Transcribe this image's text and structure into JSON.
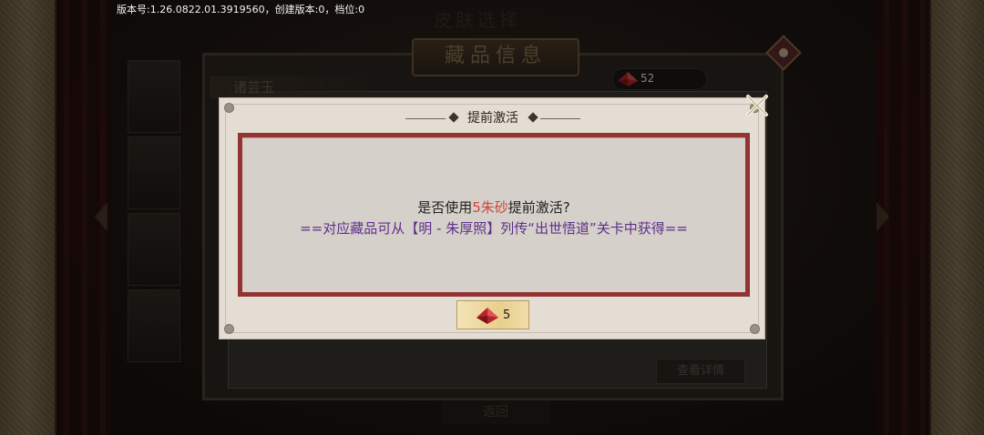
{
  "version_info": "版本号:1.26.0822.01.3919560，创建版本:0，档位:0",
  "background": {
    "screen_title": "皮肤选择",
    "banner_title": "藏品信息",
    "character_name": "诸芸玉",
    "currency_amount": "52",
    "detail_button": "查看详情",
    "return_button": "返回"
  },
  "dialog": {
    "title": "提前激活",
    "question_prefix": "是否使用",
    "question_highlight": "5朱砂",
    "question_suffix": "提前激活?",
    "hint": "==对应藏品可从【明 - 朱厚照】列传“出世悟道”关卡中获得==",
    "cost_amount": "5",
    "cost_icon": "cinnabar-gem-icon",
    "close_icon": "close-icon"
  },
  "colors": {
    "highlight_red": "#d1453b",
    "hint_purple": "#5e2f8e",
    "box_border": "#933432",
    "gem_red": "#b3252a"
  }
}
